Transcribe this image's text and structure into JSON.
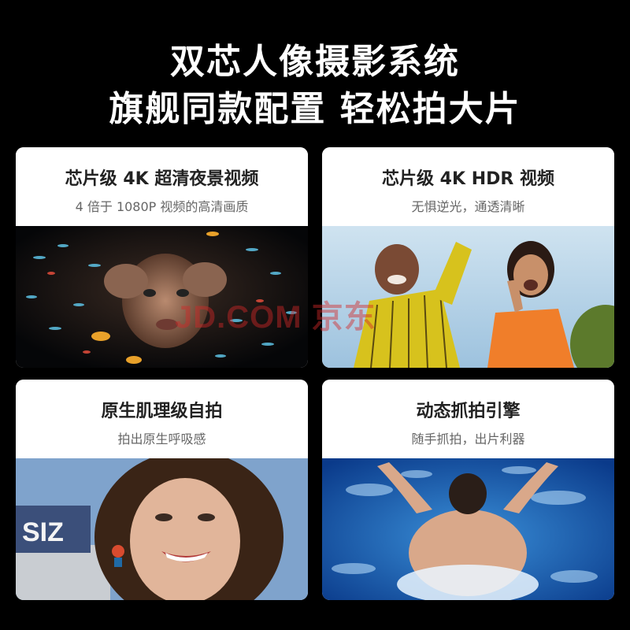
{
  "header": {
    "line1": "双芯人像摄影系统",
    "line2": "旗舰同款配置 轻松拍大片"
  },
  "cards": [
    {
      "title": "芯片级 4K 超清夜景视频",
      "subtitle": "4 倍于 1080P 视频的高清画质"
    },
    {
      "title": "芯片级 4K HDR 视频",
      "subtitle": "无惧逆光，通透清晰"
    },
    {
      "title": "原生肌理级自拍",
      "subtitle": "拍出原生呼吸感"
    },
    {
      "title": "动态抓拍引擎",
      "subtitle": "随手抓拍，出片利器"
    }
  ],
  "watermark": "JD.COM 京东"
}
